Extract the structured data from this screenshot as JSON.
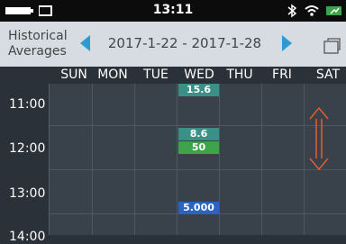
{
  "status_bar": {
    "time": "13:11",
    "icons": [
      "battery-icon",
      "bluetooth-icon",
      "wifi-icon",
      "charging-battery-icon"
    ]
  },
  "header": {
    "title_line1": "Historical",
    "title_line2": "Averages",
    "date_range": "2017-1-22 - 2017-1-28",
    "icons": [
      "prev-arrow-icon",
      "next-arrow-icon",
      "resize-icon"
    ]
  },
  "days": [
    "SUN",
    "MON",
    "TUE",
    "WED",
    "THU",
    "FRI",
    "SAT"
  ],
  "times": [
    "11:00",
    "12:00",
    "13:00",
    "14:00"
  ],
  "events": [
    {
      "day": "WED",
      "value": "15.6"
    },
    {
      "day": "WED",
      "value": "8.6"
    },
    {
      "day": "WED",
      "value": "50"
    },
    {
      "day": "WED",
      "value": "5.000"
    }
  ],
  "colors": {
    "accent_blue": "#2b9bd3",
    "header_bg": "#d6dce2",
    "grid_bg": "#39414a",
    "event_teal": "#3a8f86",
    "event_green": "#3ea34a",
    "event_blue": "#2a64c1",
    "drag_handle": "#e0602e"
  }
}
